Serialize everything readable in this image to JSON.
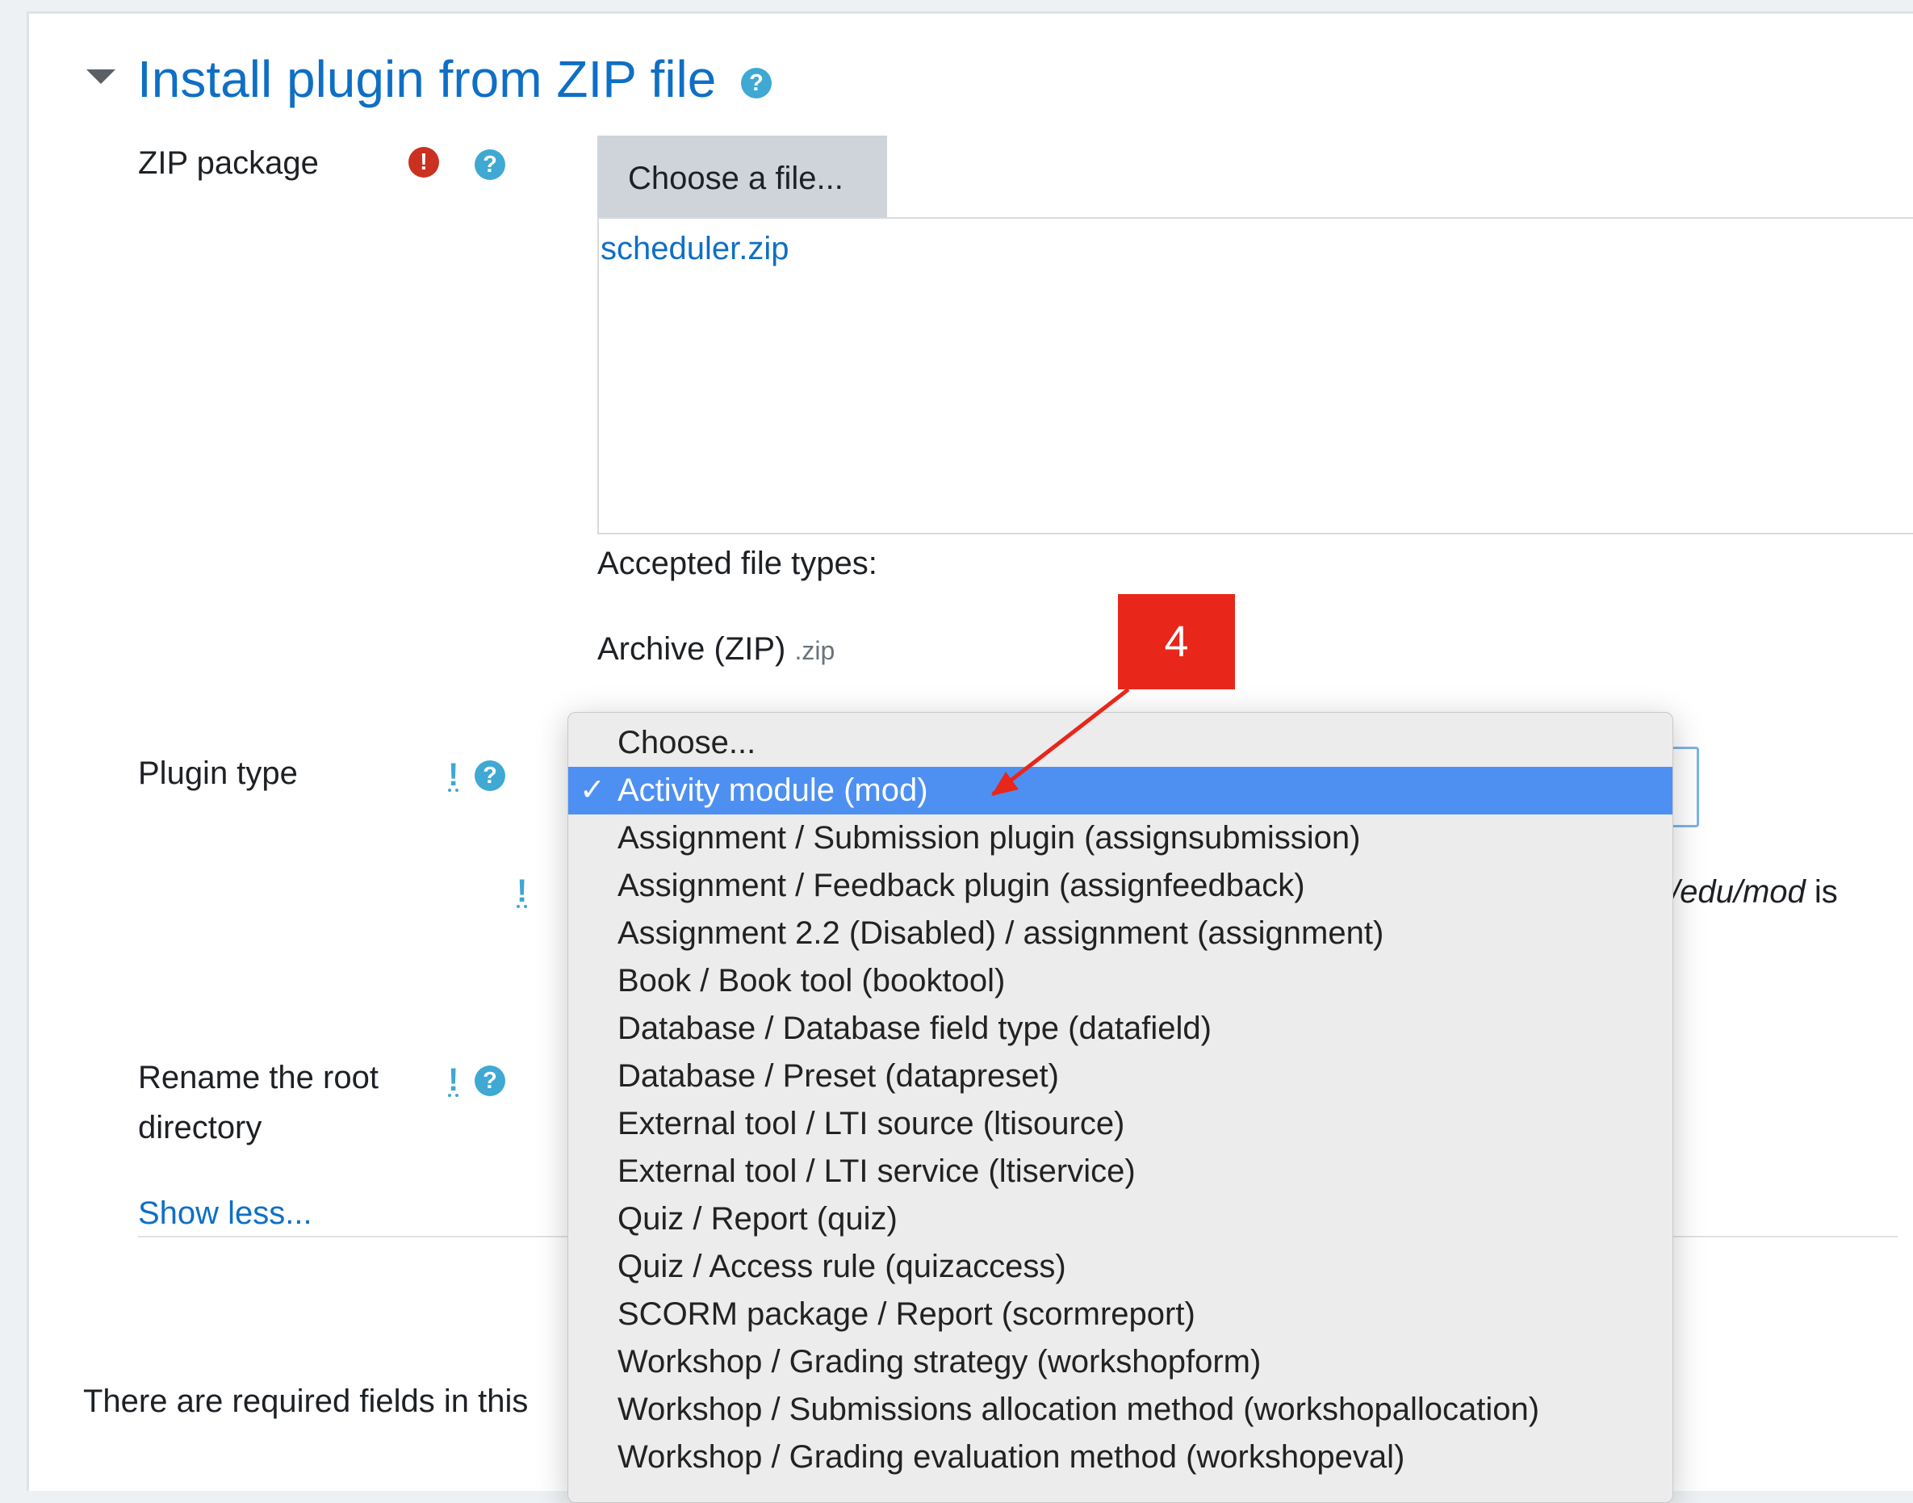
{
  "section": {
    "title": "Install plugin from ZIP file"
  },
  "zip_package": {
    "label": "ZIP package",
    "choose_button": "Choose a file...",
    "file_name": "scheduler.zip",
    "accepted_label": "Accepted file types:",
    "accepted_type": "Archive (ZIP)",
    "accepted_ext": ".zip"
  },
  "plugin_type": {
    "label": "Plugin type",
    "options": [
      "Choose...",
      "Activity module (mod)",
      "Assignment / Submission plugin (assignsubmission)",
      "Assignment / Feedback plugin (assignfeedback)",
      "Assignment 2.2 (Disabled) / assignment (assignment)",
      "Book / Book tool (booktool)",
      "Database / Database field type (datafield)",
      "Database / Preset (datapreset)",
      "External tool / LTI source (ltisource)",
      "External tool / LTI service (ltiservice)",
      "Quiz / Report (quiz)",
      "Quiz / Access rule (quizaccess)",
      "SCORM package / Report (scormreport)",
      "Workshop / Grading strategy (workshopform)",
      "Workshop / Submissions allocation method (workshopallocation)",
      "Workshop / Grading evaluation method (workshopeval)"
    ],
    "selected_index": 1,
    "path_fragment": "/edu/mod",
    "path_suffix": " is"
  },
  "rename_root": {
    "label_line1": "Rename the root",
    "label_line2": "directory"
  },
  "show_less": "Show less...",
  "required_note": "There are required fields in this",
  "callout": {
    "number": "4",
    "color": "#e8261a"
  },
  "icons": {
    "collapse": "triangle-down-icon",
    "help": "question-circle-icon",
    "required": "exclamation-circle-icon",
    "advanced": "exclamation-mark-icon",
    "check": "checkmark-icon"
  }
}
